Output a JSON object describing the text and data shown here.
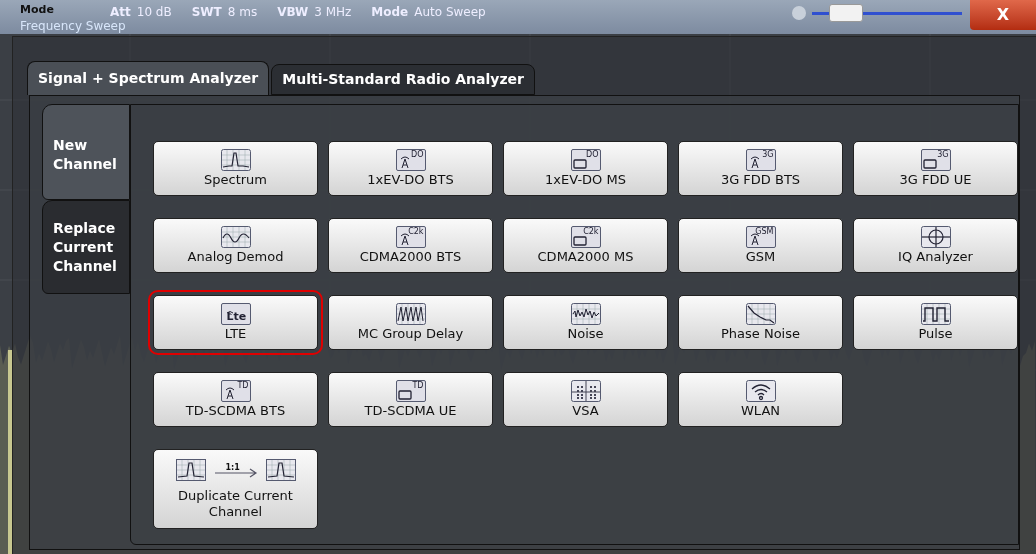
{
  "header": {
    "title": "Mode",
    "subtitle": "Frequency Sweep",
    "fields": [
      {
        "label": "Att",
        "value": "10 dB"
      },
      {
        "label": "SWT",
        "value": "8 ms"
      },
      {
        "label": "VBW",
        "value": "3 MHz"
      },
      {
        "label": "Mode",
        "value": "Auto Sweep"
      }
    ],
    "slider": {
      "level": 0.15
    },
    "close": "X"
  },
  "tabs": [
    {
      "label": "Signal + Spectrum Analyzer",
      "selected": true
    },
    {
      "label": "Multi-Standard Radio Analyzer",
      "selected": false
    }
  ],
  "side_tabs": [
    {
      "label": "New Channel",
      "selected": true
    },
    {
      "label": "Replace Current Channel",
      "selected": false
    }
  ],
  "rows": [
    [
      {
        "label": "Spectrum",
        "kind": "spectrum",
        "selected": false
      },
      {
        "label": "1xEV-DO BTS",
        "kind": "bts",
        "icon_text": "DO",
        "selected": false
      },
      {
        "label": "1xEV-DO MS",
        "kind": "ms",
        "icon_text": "DO",
        "selected": false
      },
      {
        "label": "3G FDD BTS",
        "kind": "bts",
        "icon_text": "3G",
        "selected": false
      },
      {
        "label": "3G FDD UE",
        "kind": "ms",
        "icon_text": "3G",
        "selected": false
      }
    ],
    [
      {
        "label": "Analog Demod",
        "kind": "analog",
        "selected": false
      },
      {
        "label": "CDMA2000 BTS",
        "kind": "bts",
        "icon_text": "C2k",
        "selected": false
      },
      {
        "label": "CDMA2000 MS",
        "kind": "ms",
        "icon_text": "C2k",
        "selected": false
      },
      {
        "label": "GSM",
        "kind": "gsm",
        "icon_text": "GSM",
        "selected": false
      },
      {
        "label": "IQ Analyzer",
        "kind": "iq",
        "selected": false
      }
    ],
    [
      {
        "label": "LTE",
        "kind": "lte",
        "icon_text": "Lte",
        "selected": true
      },
      {
        "label": "MC Group Delay",
        "kind": "mcgd",
        "selected": false
      },
      {
        "label": "Noise",
        "kind": "noise",
        "selected": false
      },
      {
        "label": "Phase Noise",
        "kind": "phase",
        "selected": false
      },
      {
        "label": "Pulse",
        "kind": "pulse",
        "selected": false
      }
    ],
    [
      {
        "label": "TD-SCDMA BTS",
        "kind": "bts",
        "icon_text": "TD",
        "selected": false
      },
      {
        "label": "TD-SCDMA UE",
        "kind": "ms",
        "icon_text": "TD",
        "selected": false
      },
      {
        "label": "VSA",
        "kind": "vsa",
        "selected": false
      },
      {
        "label": "WLAN",
        "kind": "wlan",
        "selected": false
      }
    ],
    [
      {
        "label": "Duplicate Current Channel",
        "kind": "duplicate",
        "icon_text": "1:1",
        "selected": false
      }
    ]
  ]
}
